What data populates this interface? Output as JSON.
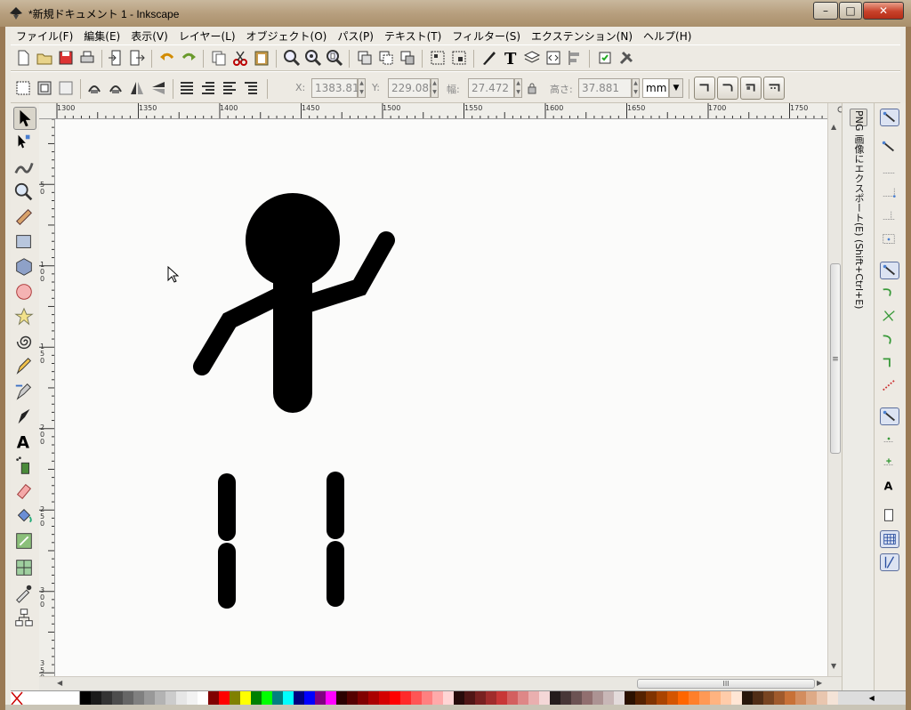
{
  "window": {
    "title": "*新規ドキュメント 1 - Inkscape",
    "minimize": "–",
    "maximize": "□",
    "close": "✕"
  },
  "menu": [
    "ファイル(F)",
    "編集(E)",
    "表示(V)",
    "レイヤー(L)",
    "オブジェクト(O)",
    "パス(P)",
    "テキスト(T)",
    "フィルター(S)",
    "エクステンション(N)",
    "ヘルプ(H)"
  ],
  "controls": {
    "x_label": "X:",
    "x_value": "1383.81",
    "y_label": "Y:",
    "y_value": "229.085",
    "w_label": "幅:",
    "w_value": "27.472",
    "h_label": "高さ:",
    "h_value": "37.881",
    "unit": "mm"
  },
  "ruler": {
    "h_labels": [
      "1300",
      "1350",
      "1400",
      "1450",
      "1500",
      "1550",
      "1600",
      "1650",
      "1700",
      "1750"
    ],
    "v_labels": [
      "50",
      "100",
      "150",
      "200",
      "250",
      "300",
      "350"
    ]
  },
  "dock": {
    "export_label": "PNG 画像にエクスポート(E) (Shift+Ctrl+E)"
  },
  "hscroll_thumb": "III",
  "vscroll_thumb": "≡",
  "colors": {
    "palette": [
      "#000000",
      "#1a1a1a",
      "#333333",
      "#4d4d4d",
      "#666666",
      "#808080",
      "#999999",
      "#b3b3b3",
      "#cccccc",
      "#e6e6e6",
      "#f2f2f2",
      "#ffffff",
      "#800000",
      "#ff0000",
      "#808000",
      "#ffff00",
      "#008000",
      "#00ff00",
      "#008080",
      "#00ffff",
      "#000080",
      "#0000ff",
      "#800080",
      "#ff00ff",
      "#2b0000",
      "#550000",
      "#800000",
      "#aa0000",
      "#d40000",
      "#ff0000",
      "#ff2a2a",
      "#ff5555",
      "#ff8080",
      "#ffaaaa",
      "#ffd5d5",
      "#280b0b",
      "#501616",
      "#782121",
      "#a02c2c",
      "#c83737",
      "#d35f5f",
      "#de8787",
      "#e9afaf",
      "#f4d7d7",
      "#241c1c",
      "#483737",
      "#6c5353",
      "#916f6f",
      "#ac9393",
      "#c8b7b7",
      "#e3dbdb",
      "#2b1100",
      "#552200",
      "#803300",
      "#aa4400",
      "#d45500",
      "#ff6600",
      "#ff7f2a",
      "#ff9955",
      "#ffb380",
      "#ffccaa",
      "#ffe6d5",
      "#28170b",
      "#502d16",
      "#784421",
      "#a05a2c",
      "#c87137",
      "#d38d5f",
      "#deaa87",
      "#e9c6af",
      "#f4e3d7"
    ]
  }
}
